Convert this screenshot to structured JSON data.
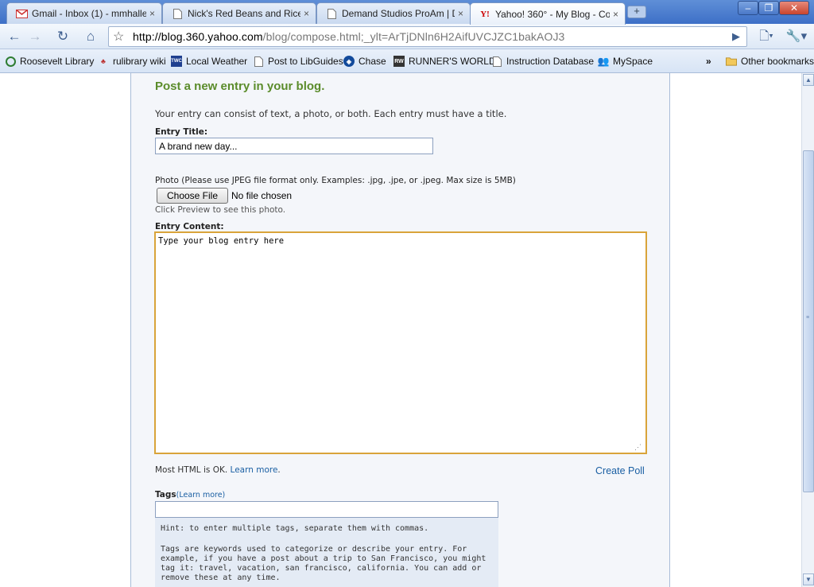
{
  "browser": {
    "tabs": [
      {
        "title": "Gmail - Inbox (1) - mmhalle...",
        "favicon": "gmail-icon",
        "close": "×"
      },
      {
        "title": "Nick's Red Beans and Rice ...",
        "favicon": "page-icon",
        "close": "×"
      },
      {
        "title": "Demand Studios ProAm | D...",
        "favicon": "page-icon",
        "close": "×"
      },
      {
        "title": "Yahoo! 360° - My Blog - Co...",
        "favicon": "yahoo-icon",
        "close": "×"
      }
    ],
    "new_tab": "+",
    "url_host": "http://blog.360.yahoo.com",
    "url_path": "/blog/compose.html;_ylt=ArTjDNln6H2AifUVCJZC1bakAOJ3",
    "bookmarks": [
      {
        "label": "Roosevelt Library",
        "icon": "roosevelt-library-icon"
      },
      {
        "label": "rulibrary wiki",
        "icon": "plant-icon"
      },
      {
        "label": "Local Weather",
        "icon": "twc-icon"
      },
      {
        "label": "Post to LibGuides",
        "icon": "page-icon"
      },
      {
        "label": "Chase",
        "icon": "chase-icon"
      },
      {
        "label": "RUNNER'S WORLD",
        "icon": "rw-icon"
      },
      {
        "label": "Instruction Database",
        "icon": "page-icon"
      },
      {
        "label": "MySpace",
        "icon": "myspace-icon"
      }
    ],
    "bookmarks_overflow": "»",
    "other_bookmarks": "Other bookmarks",
    "colors": {
      "tabstrip": "#3d6fc7",
      "accent_green": "#5b8c2b",
      "link": "#1a5fa3",
      "editor_border": "#d9a43a"
    }
  },
  "form": {
    "heading": "Post a new entry in your blog.",
    "intro": "Your entry can consist of text, a photo, or both. Each entry must have a title.",
    "entry_title_label": "Entry Title:",
    "entry_title_value": "A brand new day...",
    "photo_label": "Photo (Please use JPEG file format only. Examples: .jpg, .jpe, or .jpeg. Max size is 5MB)",
    "choose_file": "Choose File",
    "no_file": "No file chosen",
    "preview_hint": "Click Preview to see this photo.",
    "entry_content_label": "Entry Content:",
    "entry_content_value": "Type your blog entry here",
    "html_ok_text": "Most HTML is OK.",
    "learn_more": "Learn more",
    "period": ".",
    "create_poll": "Create Poll",
    "tags_label": "Tags",
    "tags_learn_more": "(Learn more)",
    "tags_hint": "Hint: to enter multiple tags, separate them with commas.",
    "tags_description": "Tags are keywords used to categorize or describe your entry. For example, if you have a post about a trip to San Francisco, you might tag it: travel, vacation, san francisco, california. You can add or remove these at any time."
  }
}
